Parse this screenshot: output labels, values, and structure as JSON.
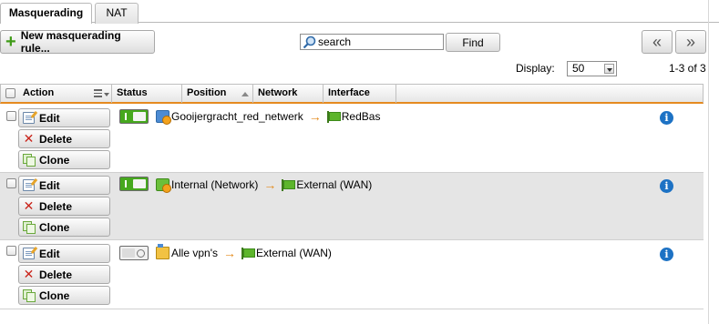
{
  "tabs": [
    {
      "label": "Masquerading",
      "active": true
    },
    {
      "label": "NAT",
      "active": false
    }
  ],
  "toolbar": {
    "new_rule_label": "New masquerading rule...",
    "search_placeholder": "search",
    "find_label": "Find",
    "prev_label": "«",
    "next_label": "»"
  },
  "display": {
    "label": "Display:",
    "value": "50",
    "count": "1-3 of 3"
  },
  "columns": {
    "action": "Action",
    "status": "Status",
    "position": "Position",
    "network": "Network",
    "interface": "Interface"
  },
  "buttons": {
    "edit": "Edit",
    "delete": "Delete",
    "clone": "Clone"
  },
  "rules": [
    {
      "enabled": true,
      "network": "Gooijergracht_red_netwerk",
      "network_icon": "network-icon",
      "interface": "RedBas"
    },
    {
      "enabled": true,
      "network": "Internal (Network)",
      "network_icon": "network-icon",
      "interface": "External (WAN)"
    },
    {
      "enabled": false,
      "network": "Alle vpn's",
      "network_icon": "vpn-folder-icon",
      "interface": "External (WAN)"
    }
  ],
  "arrow_glyph": "→",
  "info_glyph": "i",
  "colors": {
    "accent": "#e58a1f",
    "toggle_on": "#46a81e",
    "info": "#1d72c4"
  }
}
